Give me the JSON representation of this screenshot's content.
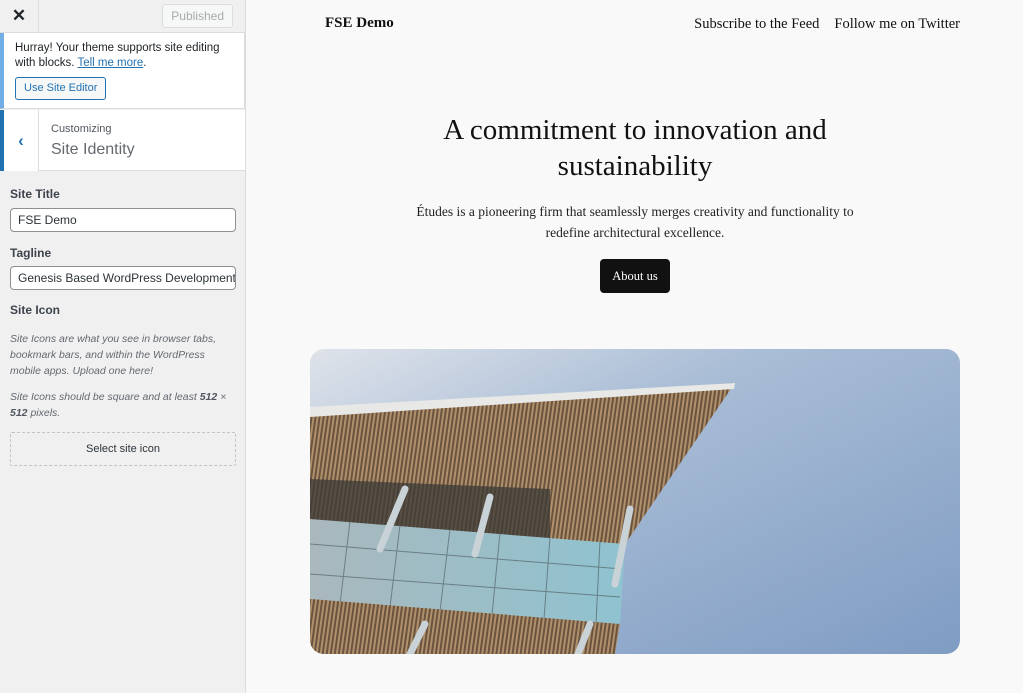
{
  "sidebar": {
    "close_icon": "close-icon",
    "published_label": "Published",
    "notice": {
      "text": "Hurray! Your theme supports site editing with blocks.",
      "link": "Tell me more",
      "suffix": ".",
      "button": "Use Site Editor"
    },
    "section": {
      "breadcrumb": "Customizing",
      "title": "Site Identity",
      "back_icon": "chevron-left-icon"
    },
    "fields": {
      "site_title_label": "Site Title",
      "site_title_value": "FSE Demo",
      "tagline_label": "Tagline",
      "tagline_value": "Genesis Based WordPress Development",
      "site_icon_label": "Site Icon",
      "site_icon_desc": "Site Icons are what you see in browser tabs, bookmark bars, and within the WordPress mobile apps. Upload one here!",
      "site_icon_size_pre": "Site Icons should be square and at least ",
      "site_icon_size_bold1": "512",
      "site_icon_size_mid": " × ",
      "site_icon_size_bold2": "512",
      "site_icon_size_post": " pixels.",
      "select_icon_button": "Select site icon"
    },
    "colors": {
      "accent": "#2271b1",
      "notice_border": "#72aee6"
    }
  },
  "preview": {
    "site_name": "FSE Demo",
    "nav": [
      "Subscribe to the Feed",
      "Follow me on Twitter"
    ],
    "hero_title_line1": "A commitment to innovation and",
    "hero_title_line2": "sustainability",
    "hero_desc": "Études is a pioneering firm that seamlessly merges creativity and functionality to redefine architectural excellence.",
    "cta": "About us",
    "image_alt": "Modern building with wooden slat canopy against blue sky"
  }
}
